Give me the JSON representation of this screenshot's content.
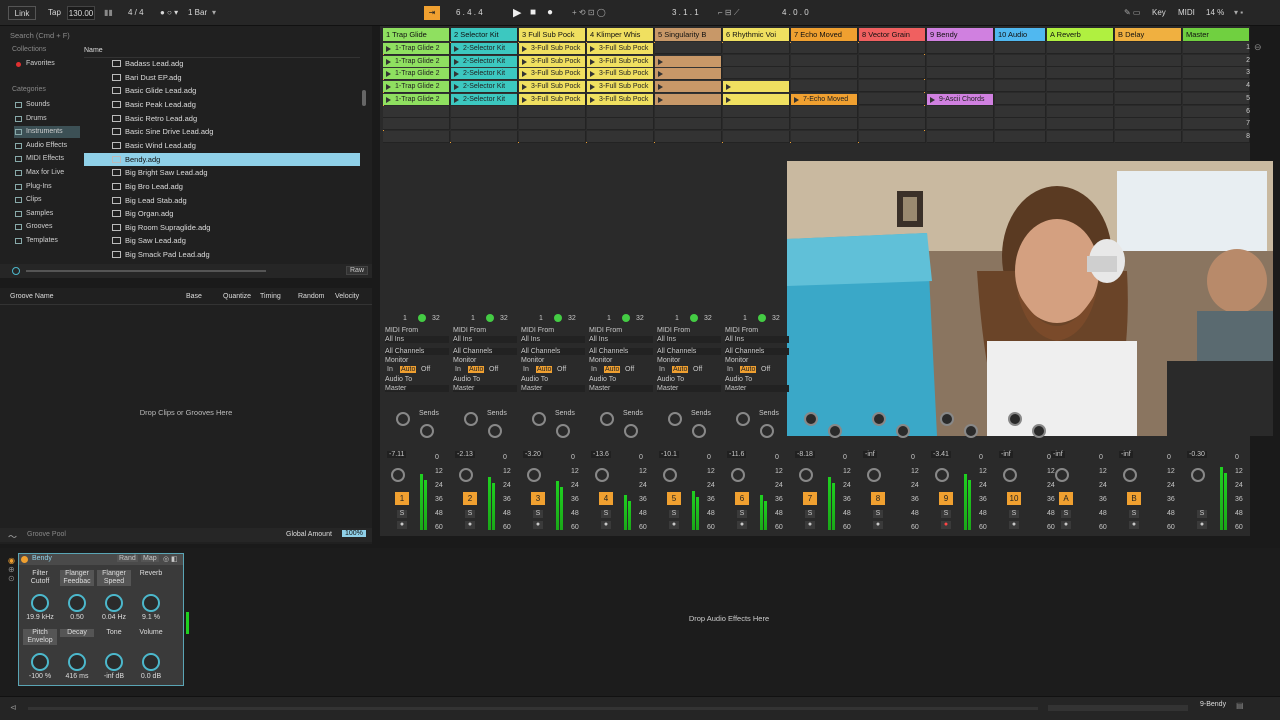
{
  "topbar": {
    "link": "Link",
    "tap": "Tap",
    "tempo": "130.00",
    "sig": "4 / 4",
    "quant": "1 Bar",
    "pos": "6 .  4 .  4",
    "loop_start": "3 .  1 .  1",
    "loop_len": "4 .  0 .  0",
    "key": "Key",
    "midi": "MIDI",
    "cpu": "14 %"
  },
  "browser": {
    "search_placeholder": "Search (Cmd + F)",
    "collections_title": "Collections",
    "favorites": "Favorites",
    "categories_title": "Categories",
    "categories": [
      "Sounds",
      "Drums",
      "Instruments",
      "Audio Effects",
      "MIDI Effects",
      "Max for Live",
      "Plug-Ins",
      "Clips",
      "Samples",
      "Grooves",
      "Templates"
    ],
    "name_header": "Name",
    "files": [
      "Badass Lead.adg",
      "Bari Dust EP.adg",
      "Basic Glide Lead.adg",
      "Basic Peak Lead.adg",
      "Basic Retro Lead.adg",
      "Basic Sine Drive Lead.adg",
      "Basic Wind Lead.adg",
      "Bendy.adg",
      "Big Bright Saw Lead.adg",
      "Big Bro Lead.adg",
      "Big Lead Stab.adg",
      "Big Organ.adg",
      "Big Room Supraglide.adg",
      "Big Saw Lead.adg",
      "Big Smack Pad Lead.adg"
    ],
    "selected_index": 7,
    "raw": "Raw"
  },
  "groove": {
    "headers": [
      "Groove Name",
      "Base",
      "Quantize",
      "Timing",
      "Random",
      "Velocity"
    ],
    "drop_text": "Drop Clips or Grooves Here",
    "pool": "Groove Pool",
    "global": "Global Amount",
    "global_val": "100%"
  },
  "tracks": [
    {
      "name": "1 Trap Glide",
      "color": "#8fe060",
      "num": "1",
      "vol": "-7.11"
    },
    {
      "name": "2 Selector Kit",
      "color": "#3cc8c0",
      "num": "2",
      "vol": "-2.13"
    },
    {
      "name": "3 Full Sub Pock",
      "color": "#f0e060",
      "num": "3",
      "vol": "-3.20"
    },
    {
      "name": "4 Klimper Whis",
      "color": "#f0e060",
      "num": "4",
      "vol": "-13.6"
    },
    {
      "name": "5 Singularity B",
      "color": "#c89868",
      "num": "5",
      "vol": "-10.1"
    },
    {
      "name": "6 Rhythmic Voi",
      "color": "#f0e060",
      "num": "6",
      "vol": "-11.6"
    },
    {
      "name": "7 Echo Moved",
      "color": "#f0a030",
      "num": "7",
      "vol": "-8.18"
    },
    {
      "name": "8 Vector Grain",
      "color": "#f06060",
      "num": "8",
      "vol": "-inf"
    },
    {
      "name": "9 Bendy",
      "color": "#d080e0",
      "num": "9",
      "vol": "-3.41"
    },
    {
      "name": "10 Audio",
      "color": "#50b8f0",
      "num": "10",
      "vol": "-inf"
    },
    {
      "name": "A Reverb",
      "color": "#b0f040",
      "num": "A",
      "vol": "-inf"
    },
    {
      "name": "B Delay",
      "color": "#f0b040",
      "num": "B",
      "vol": "-inf"
    },
    {
      "name": "Master",
      "color": "#70d040",
      "num": "",
      "vol": "-0.30"
    }
  ],
  "clips": {
    "trap": "1-Trap Glide 2",
    "selector": "2-Selector Kit",
    "sub": "3-Full Sub Pock",
    "full": "3-Full Sub Pock",
    "echo": "7-Echo Moved",
    "ascii": "9-Ascii Chords"
  },
  "io": {
    "midi_from": "MIDI From",
    "all_ins": "All Ins",
    "all_channels": "All Channels",
    "monitor": "Monitor",
    "in": "In",
    "auto": "Auto",
    "off": "Off",
    "audio_to": "Audio To",
    "master": "Master",
    "sends": "Sends"
  },
  "rack": {
    "name": "Bendy",
    "rand": "Rand",
    "map": "Map",
    "macros": [
      {
        "label": "Filter Cutoff",
        "value": "19.9 kHz"
      },
      {
        "label": "Flanger Feedbac",
        "value": "0.50"
      },
      {
        "label": "Flanger Speed",
        "value": "0.04 Hz"
      },
      {
        "label": "Reverb",
        "value": "9.1 %"
      },
      {
        "label": "Pitch Envelop",
        "value": "-100 %"
      },
      {
        "label": "Decay",
        "value": "416 ms"
      },
      {
        "label": "Tone",
        "value": "-inf dB"
      },
      {
        "label": "Volume",
        "value": "0.0 dB"
      }
    ]
  },
  "device_drop": "Drop Audio Effects Here",
  "status_right": "9-Bendy"
}
